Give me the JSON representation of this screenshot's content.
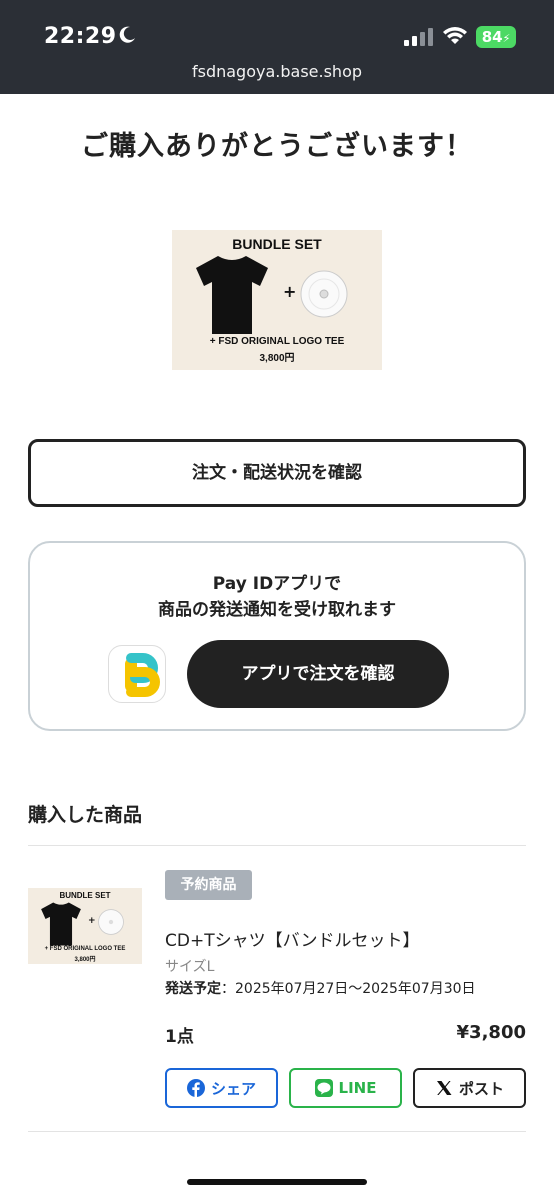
{
  "status_bar": {
    "time": "22:29",
    "battery": "84"
  },
  "browser": {
    "url": "fsdnagoya.base.shop"
  },
  "page": {
    "headline": "ご購入ありがとうございます！"
  },
  "hero_image": {
    "title": "BUNDLE SET",
    "line1": "+ FSD ORIGINAL LOGO TEE",
    "line2": "3,800円"
  },
  "order_status_button": "注文・配送状況を確認",
  "payid": {
    "line1": "Pay IDアプリで",
    "line2": "商品の発送通知を受け取れます",
    "button": "アプリで注文を確認"
  },
  "purchased": {
    "section_title": "購入した商品",
    "item": {
      "badge": "予約商品",
      "name": "CD+Tシャツ【バンドルセット】",
      "size": "サイズL",
      "ship_label": "発送予定",
      "ship_value": "：2025年07月27日〜2025年07月30日",
      "qty": "1点",
      "price": "¥3,800"
    },
    "share": {
      "facebook": "シェア",
      "line": "LINE",
      "x": "ポスト"
    }
  },
  "colors": {
    "facebook": "#1a66d8",
    "line": "#2ab34a",
    "dark": "#222222",
    "badge": "#a9b0b8",
    "image_bg": "#f3ece1"
  }
}
